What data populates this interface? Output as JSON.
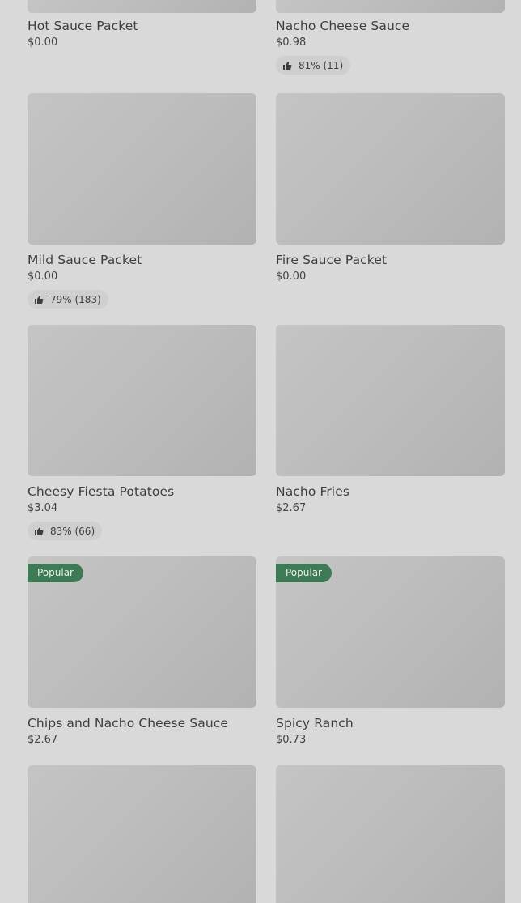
{
  "cards": [
    {
      "name": "Hot Sauce Packet",
      "price": "$0.00"
    },
    {
      "name": "Nacho Cheese Sauce",
      "price": "$0.98",
      "rating": "81% (11)"
    },
    {
      "name": "Mild Sauce Packet",
      "price": "$0.00",
      "rating": "79% (183)"
    },
    {
      "name": "Fire Sauce Packet",
      "price": "$0.00"
    },
    {
      "name": "Cheesy Fiesta Potatoes",
      "price": "$3.04",
      "rating": "83% (66)"
    },
    {
      "name": "Nacho Fries",
      "price": "$2.67"
    },
    {
      "name": "Chips and Nacho Cheese Sauce",
      "price": "$2.67",
      "badge": "Popular"
    },
    {
      "name": "Spicy Ranch",
      "price": "$0.73",
      "badge": "Popular"
    }
  ],
  "colors": {
    "badge_bg": "#3d7a55",
    "background": "#d9d9d9"
  },
  "icons": {
    "rating": "thumbs-up-icon"
  }
}
